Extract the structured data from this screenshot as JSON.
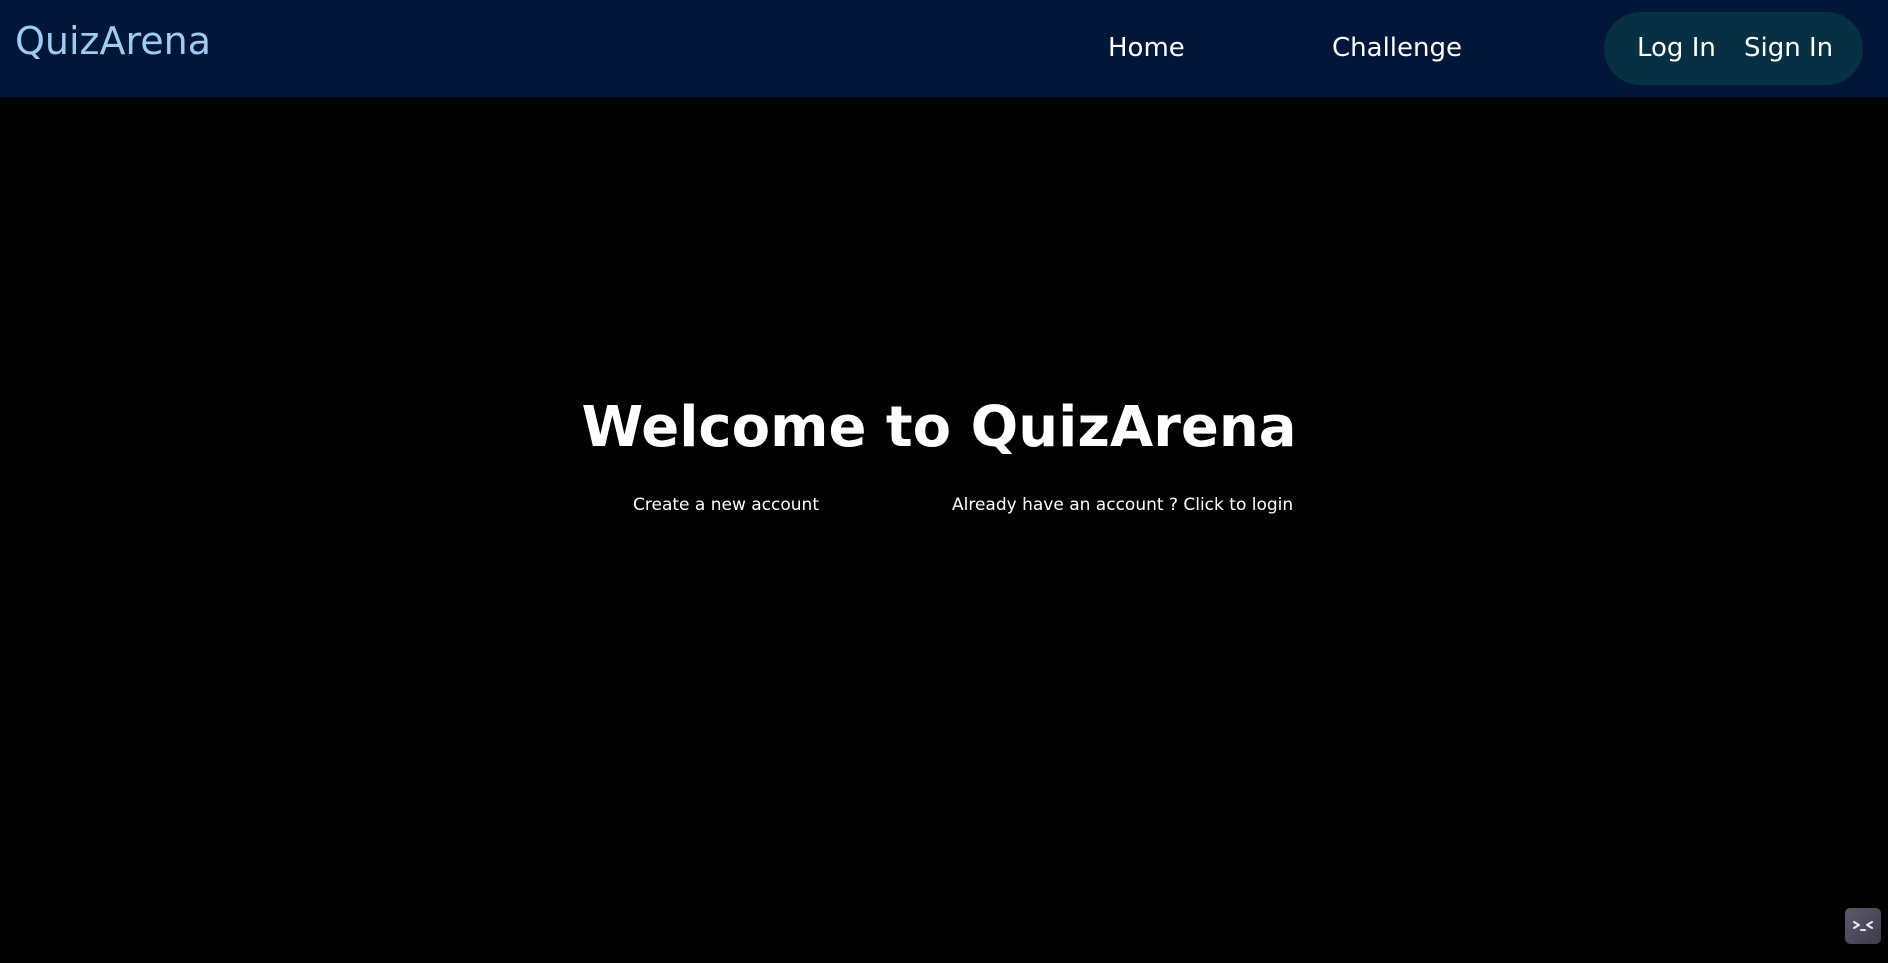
{
  "header": {
    "brand": "QuizArena",
    "nav": {
      "home": "Home",
      "challenge": "Challenge"
    },
    "auth": {
      "login": "Log In",
      "signin": "Sign In"
    }
  },
  "main": {
    "title": "Welcome to QuizArena",
    "create_account_link": "Create a new account",
    "login_link": "Already have an account ? Click to login"
  },
  "widget": {
    "icon": "dev-tools-icon"
  },
  "colors": {
    "navbar_bg": "#01173a",
    "brand": "#9ecbf0",
    "auth_pill_bg": "#073042",
    "page_bg": "#000000"
  }
}
